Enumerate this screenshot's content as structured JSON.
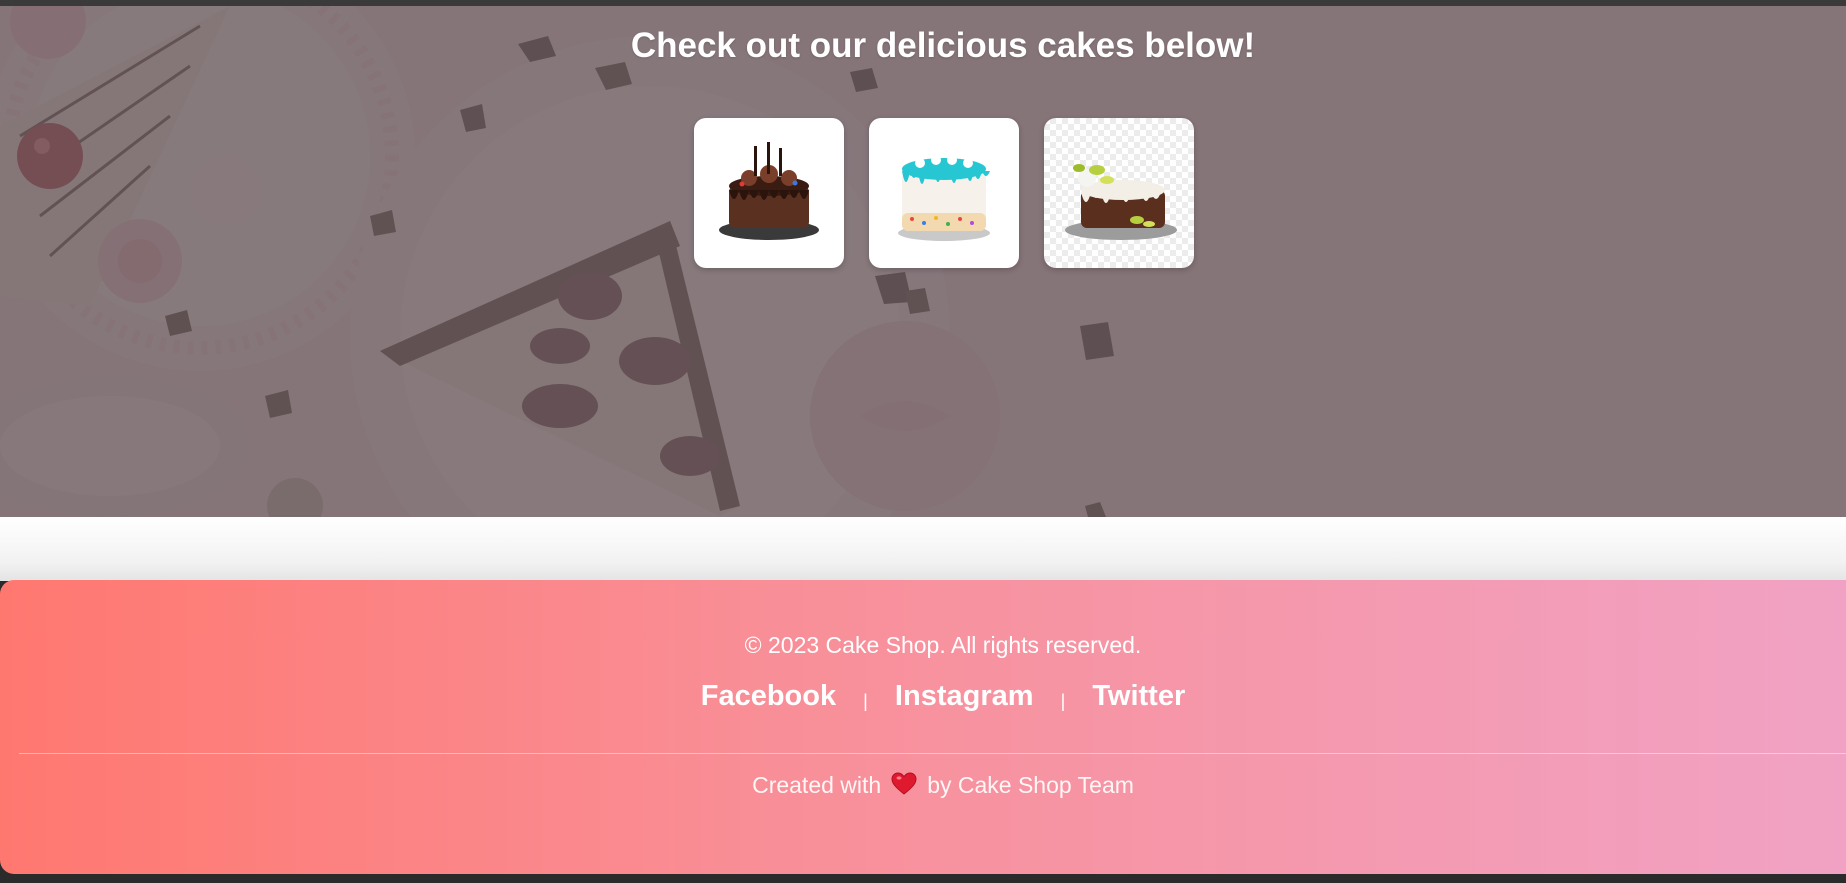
{
  "hero": {
    "title": "Check out our delicious cakes below!",
    "cakes": [
      {
        "name": "chocolate-drip-cake"
      },
      {
        "name": "blue-drip-sprinkle-cake"
      },
      {
        "name": "white-chocolate-drip-cake"
      }
    ]
  },
  "footer": {
    "copyright": "© 2023 Cake Shop. All rights reserved.",
    "social": {
      "facebook": "Facebook",
      "instagram": "Instagram",
      "twitter": "Twitter",
      "separator": "|"
    },
    "credits": {
      "prefix": "Created with",
      "suffix": "by Cake Shop Team"
    }
  },
  "colors": {
    "footer_gradient_start": "#ff7870",
    "footer_gradient_end": "#f1a2c4",
    "hero_overlay": "#75676a"
  }
}
